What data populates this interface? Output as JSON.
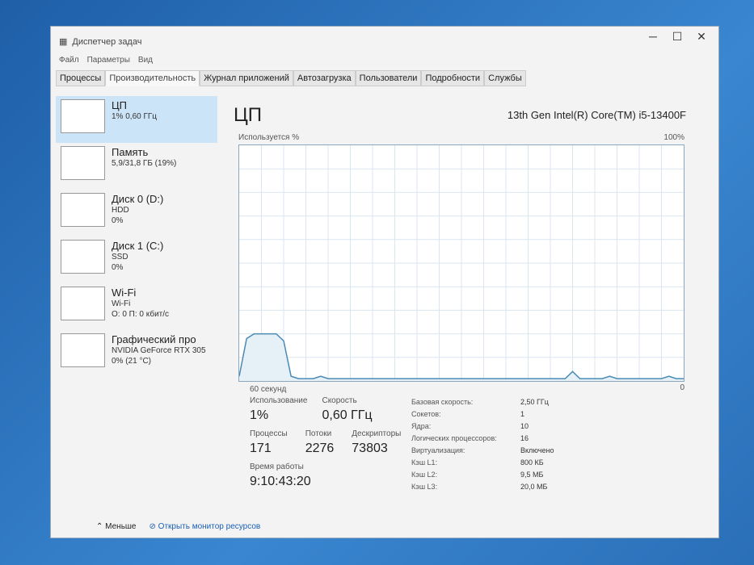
{
  "window": {
    "title": "Диспетчер задач",
    "menu": [
      "Файл",
      "Параметры",
      "Вид"
    ],
    "tabs": [
      "Процессы",
      "Производительность",
      "Журнал приложений",
      "Автозагрузка",
      "Пользователи",
      "Подробности",
      "Службы"
    ],
    "active_tab": 1
  },
  "sidebar": [
    {
      "name": "ЦП",
      "l1": "1% 0,60 ГГц",
      "l2": "",
      "l3": ""
    },
    {
      "name": "Память",
      "l1": "5,9/31,8 ГБ (19%)",
      "l2": "",
      "l3": ""
    },
    {
      "name": "Диск 0 (D:)",
      "l1": "HDD",
      "l2": "0%",
      "l3": ""
    },
    {
      "name": "Диск 1 (C:)",
      "l1": "SSD",
      "l2": "0%",
      "l3": ""
    },
    {
      "name": "Wi-Fi",
      "l1": "Wi-Fi",
      "l2": "О: 0 П: 0 кбит/с",
      "l3": ""
    },
    {
      "name": "Графический про",
      "l1": "NVIDIA GeForce RTX 305",
      "l2": "0% (21 °C)",
      "l3": ""
    }
  ],
  "main": {
    "title": "ЦП",
    "model": "13th Gen Intel(R) Core(TM) i5-13400F",
    "usage_label": "Используется %",
    "max_label": "100%",
    "time_label": "60 секунд",
    "min_label": "0",
    "stats": {
      "usage_l": "Использование",
      "usage": "1%",
      "speed_l": "Скорость",
      "speed": "0,60 ГГц",
      "proc_l": "Процессы",
      "proc": "171",
      "threads_l": "Потоки",
      "threads": "2276",
      "handles_l": "Дескрипторы",
      "handles": "73803",
      "uptime_l": "Время работы",
      "uptime": "9:10:43:20"
    },
    "specs": [
      [
        "Базовая скорость:",
        "2,50 ГГц"
      ],
      [
        "Сокетов:",
        "1"
      ],
      [
        "Ядра:",
        "10"
      ],
      [
        "Логических процессоров:",
        "16"
      ],
      [
        "Виртуализация:",
        "Включено"
      ],
      [
        "Кэш L1:",
        "800 КБ"
      ],
      [
        "Кэш L2:",
        "9,5 МБ"
      ],
      [
        "Кэш L3:",
        "20,0 МБ"
      ]
    ]
  },
  "footer": {
    "less": "Меньше",
    "monitor": "Открыть монитор ресурсов"
  },
  "chart_data": {
    "type": "area",
    "title": "Используется %",
    "xlabel": "60 секунд",
    "ylim": [
      0,
      100
    ],
    "values": [
      2,
      18,
      20,
      20,
      20,
      20,
      17,
      2,
      1,
      1,
      1,
      2,
      1,
      1,
      1,
      1,
      1,
      1,
      1,
      1,
      1,
      1,
      1,
      1,
      1,
      1,
      1,
      1,
      1,
      1,
      1,
      1,
      1,
      1,
      1,
      1,
      1,
      1,
      1,
      1,
      1,
      1,
      1,
      1,
      1,
      4,
      1,
      1,
      1,
      1,
      2,
      1,
      1,
      1,
      1,
      1,
      1,
      1,
      2,
      1,
      1
    ],
    "color": "#4a8ab5"
  }
}
